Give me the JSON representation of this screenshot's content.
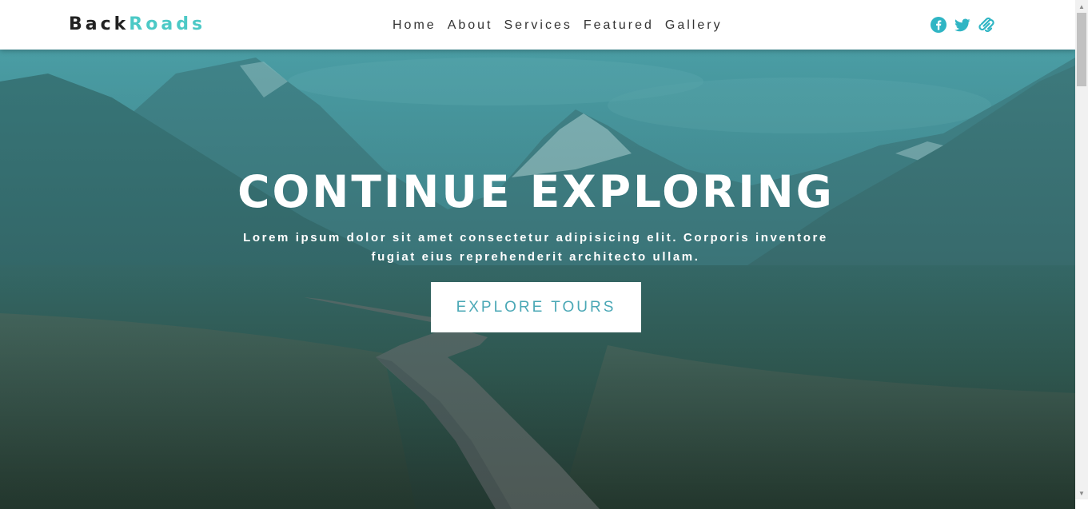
{
  "navbar": {
    "logo": {
      "part1": "Back",
      "part2": "Roads"
    },
    "links": [
      {
        "label": "Home"
      },
      {
        "label": "About"
      },
      {
        "label": "Services"
      },
      {
        "label": "Featured"
      },
      {
        "label": "Gallery"
      }
    ],
    "social": [
      {
        "icon": "facebook-icon"
      },
      {
        "icon": "twitter-icon"
      },
      {
        "icon": "squarespace-icon"
      }
    ]
  },
  "hero": {
    "title": "CONTINUE EXPLORING",
    "text": "Lorem ipsum dolor sit amet consectetur adipisicing elit. Corporis inventore fugiat eius reprehenderit architecto ullam.",
    "button": "EXPLORE TOURS"
  },
  "colors": {
    "brand": "#4cc9c6",
    "logo_dark": "#222222",
    "button_text": "#4ba8b6",
    "nav_text": "#333333"
  },
  "icons": {
    "scroll_up": "scroll-up-arrow-icon",
    "scroll_down": "scroll-down-arrow-icon"
  }
}
